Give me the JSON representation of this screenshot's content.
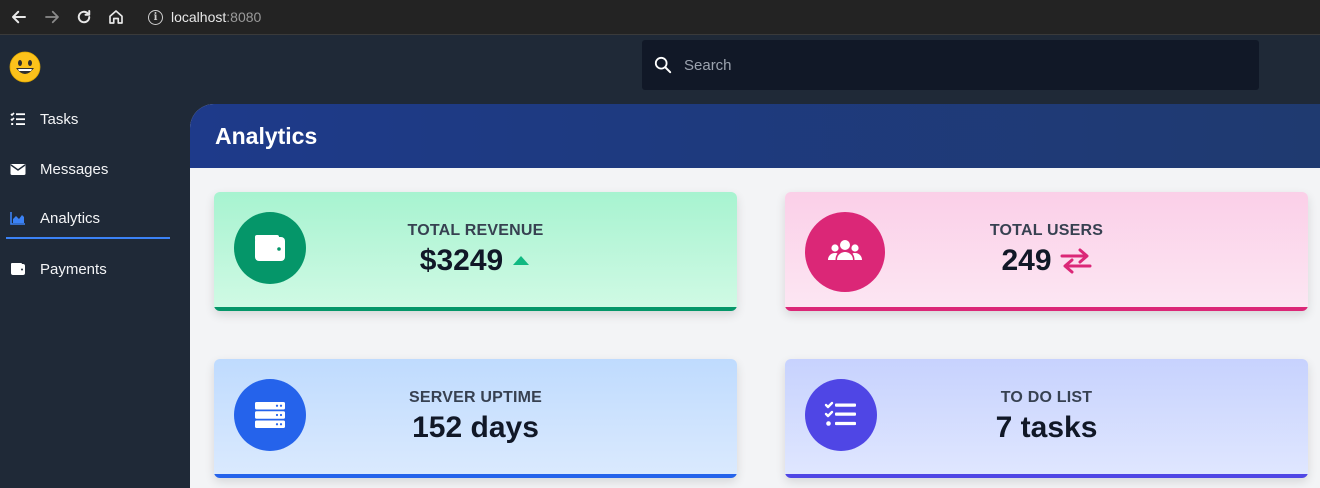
{
  "browser": {
    "host": "localhost",
    "port": ":8080"
  },
  "sidebar": {
    "logo": "smiley-emoji",
    "items": [
      {
        "label": "Tasks",
        "icon": "tasks-icon"
      },
      {
        "label": "Messages",
        "icon": "envelope-icon"
      },
      {
        "label": "Analytics",
        "icon": "chart-area-icon",
        "active": true
      },
      {
        "label": "Payments",
        "icon": "wallet-icon"
      }
    ]
  },
  "search": {
    "placeholder": "Search"
  },
  "main": {
    "title": "Analytics",
    "cards": [
      {
        "title": "TOTAL REVENUE",
        "value": "$3249",
        "icon": "wallet-icon",
        "trend": "up-arrow",
        "color": "#059669"
      },
      {
        "title": "TOTAL USERS",
        "value": "249",
        "icon": "users-icon",
        "trend": "exchange-arrows",
        "color": "#db2777"
      },
      {
        "title": "SERVER UPTIME",
        "value": "152 days",
        "icon": "server-icon",
        "color": "#2563eb"
      },
      {
        "title": "TO DO LIST",
        "value": "7 tasks",
        "icon": "tasks-icon",
        "color": "#4f46e5"
      }
    ]
  }
}
